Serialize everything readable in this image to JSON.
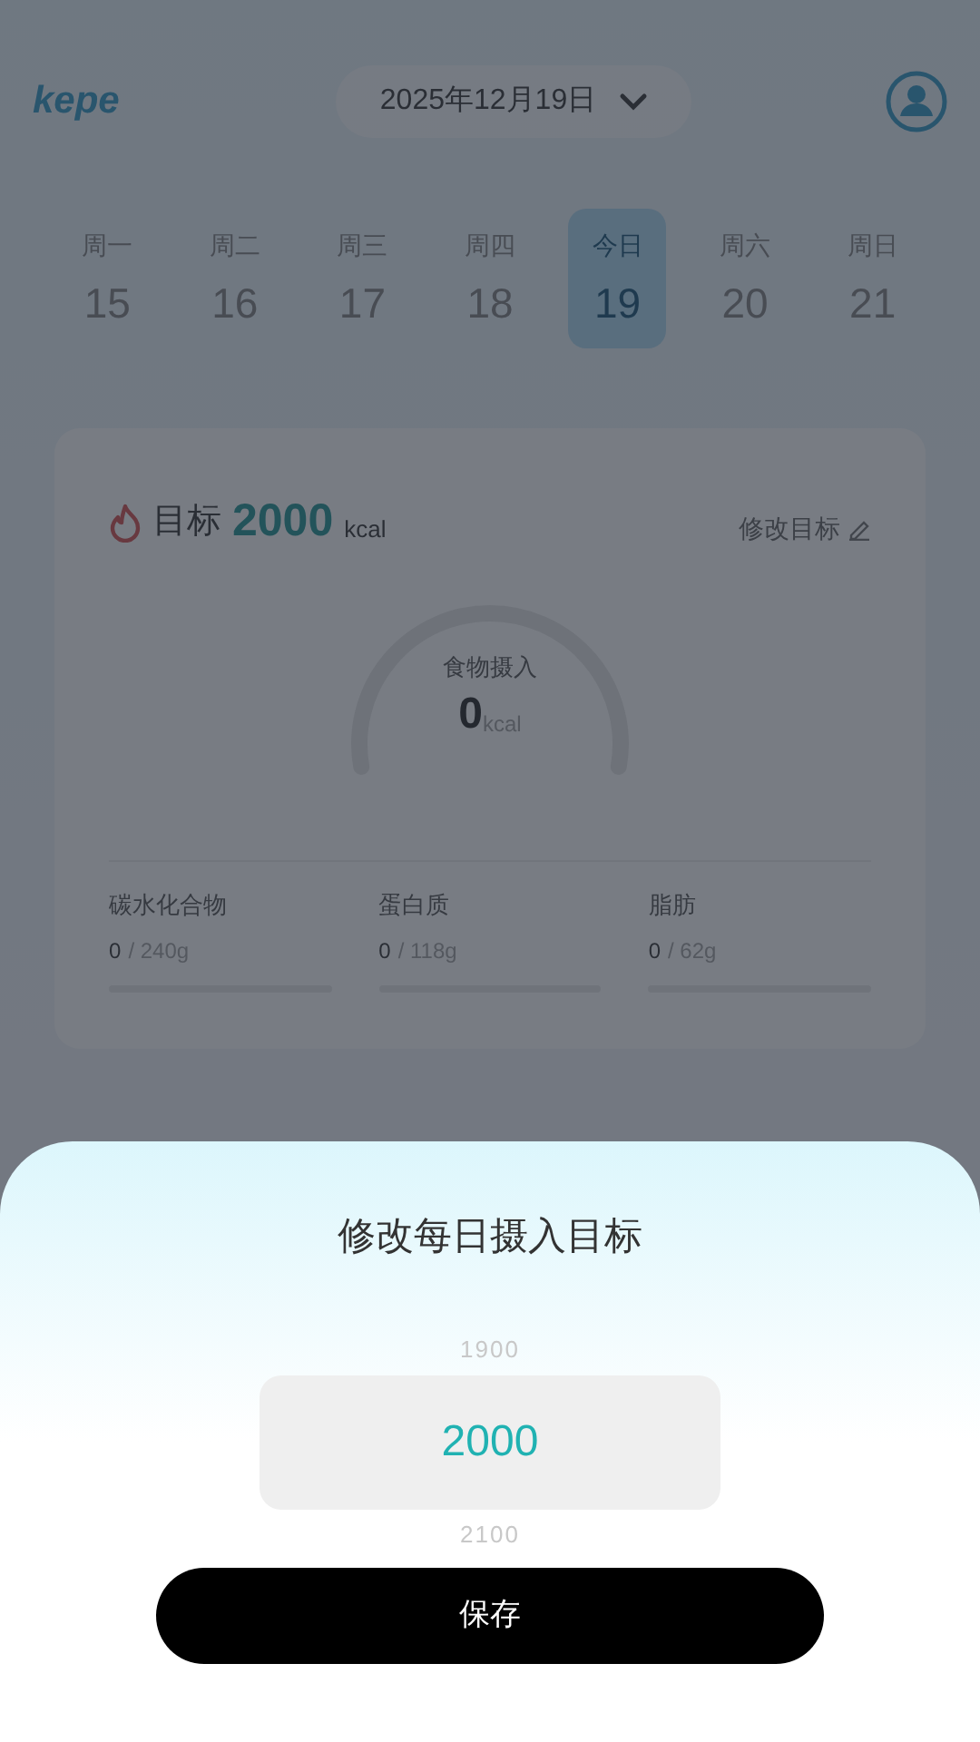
{
  "header": {
    "logo": "kepe",
    "date": "2025年12月19日"
  },
  "week": [
    {
      "label": "周一",
      "day": "15",
      "selected": false
    },
    {
      "label": "周二",
      "day": "16",
      "selected": false
    },
    {
      "label": "周三",
      "day": "17",
      "selected": false
    },
    {
      "label": "周四",
      "day": "18",
      "selected": false
    },
    {
      "label": "今日",
      "day": "19",
      "selected": true
    },
    {
      "label": "周六",
      "day": "20",
      "selected": false
    },
    {
      "label": "周日",
      "day": "21",
      "selected": false
    }
  ],
  "goal_card": {
    "label": "目标",
    "value": "2000",
    "unit": "kcal",
    "edit_link": "修改目标",
    "gauge": {
      "label": "食物摄入",
      "value": "0",
      "unit": "kcal"
    },
    "macros": [
      {
        "name": "碳水化合物",
        "current": "0",
        "total": "/ 240g",
        "level": 0
      },
      {
        "name": "蛋白质",
        "current": "0",
        "total": "/ 118g",
        "level": 0
      },
      {
        "name": "脂肪",
        "current": "0",
        "total": "/ 62g",
        "level": 0
      }
    ]
  },
  "sheet": {
    "title": "修改每日摄入目标",
    "picker": [
      {
        "value": "1900",
        "selected": false
      },
      {
        "value": "2000",
        "selected": true
      },
      {
        "value": "2100",
        "selected": false
      }
    ],
    "save_button": "保存"
  }
}
